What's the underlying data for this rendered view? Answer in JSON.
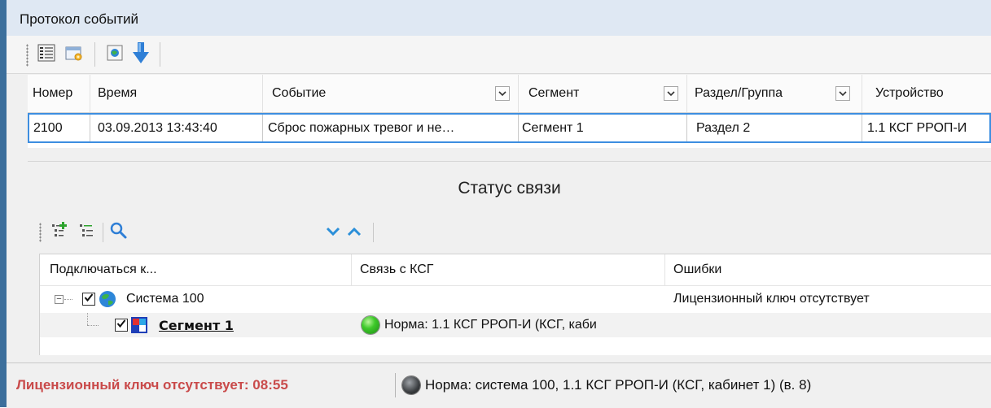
{
  "window": {
    "title": "Протокол событий"
  },
  "toolbar": {
    "buttons": [
      {
        "icon": "columns-icon"
      },
      {
        "icon": "settings-window-icon"
      },
      {
        "icon": "globe-icon"
      },
      {
        "icon": "arrow-down-icon"
      }
    ]
  },
  "events_table": {
    "columns": [
      "Номер",
      "Время",
      "Событие",
      "Сегмент",
      "Раздел/Группа",
      "Устройство"
    ],
    "rows": [
      {
        "number": "2100",
        "time": "03.09.2013 13:43:40",
        "event": "Сброс пожарных тревог и не…",
        "segment": "Сегмент 1",
        "section": "Раздел 2",
        "device": "1.1 КСГ РРОП-И"
      }
    ]
  },
  "connection_status": {
    "title": "Статус связи",
    "columns": [
      "Подключаться к...",
      "Связь с КСГ",
      "Ошибки"
    ],
    "tree": [
      {
        "name": "Система 100",
        "link": "",
        "error": "Лицензионный ключ отсутствует",
        "checked": true,
        "expanded": true
      },
      {
        "name": "Сегмент 1",
        "link": "Норма: 1.1 КСГ РРОП-И (КСГ, каби",
        "error": "",
        "checked": true
      }
    ]
  },
  "status_bar": {
    "warning": "Лицензионный ключ отсутствует: 08:55",
    "status": "Норма:  система 100, 1.1 КСГ РРОП-И (КСГ, кабинет 1) (в. 8)"
  },
  "colors": {
    "accent": "#3d8ee0",
    "warning": "#c94a4a",
    "ok": "#3ec92a",
    "title_bar": "#dfe8f3"
  }
}
